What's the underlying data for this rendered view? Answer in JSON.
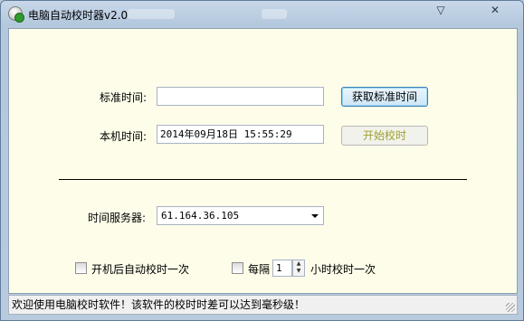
{
  "window": {
    "title": "电脑自动校时器v2.0",
    "icons": {
      "app": "clock-app-icon",
      "dropdown": "chevron-down-icon",
      "close": "close-icon"
    },
    "dropdown_glyph": "▽",
    "close_glyph": "✕"
  },
  "form": {
    "standard_time_label": "标准时间:",
    "standard_time_value": "",
    "get_standard_time_button": "获取标准时间",
    "local_time_label": "本机时间:",
    "local_time_value": "2014年09月18日 15:55:29",
    "start_sync_button": "开始校时",
    "time_server_label": "时间服务器:",
    "time_server_value": "61.164.36.105"
  },
  "options": {
    "auto_sync_on_boot_label": "开机后自动校时一次",
    "auto_sync_on_boot_checked": false,
    "every_label": "每隔",
    "interval_checked": false,
    "interval_value": "1",
    "interval_suffix": "小时校时一次"
  },
  "status": {
    "message": "欢迎使用电脑校时软件！该软件的校时时差可以达到毫秒级！"
  },
  "colors": {
    "client_bg": "#fdfde9",
    "disabled_text": "#a0a030",
    "accent_border": "#3c7fb1"
  }
}
